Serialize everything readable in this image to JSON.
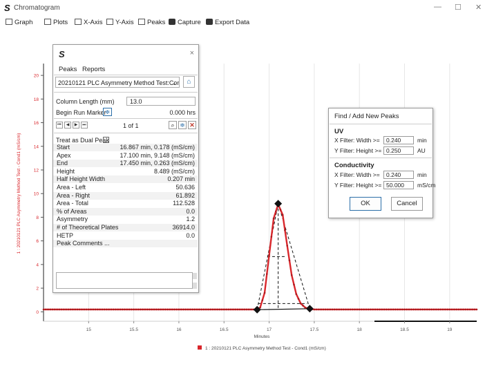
{
  "window": {
    "title": "Chromatogram",
    "logo": "S",
    "controls": [
      "—",
      "☐",
      "✕"
    ]
  },
  "toolbar": {
    "items": [
      "Graph",
      "Plots",
      "X-Axis",
      "Y-Axis",
      "Peaks",
      "Capture",
      "Export Data"
    ]
  },
  "panel": {
    "logo": "S",
    "close": "×",
    "menu": {
      "peaks": "Peaks",
      "reports": "Reports"
    },
    "selected_run": "20210121 PLC Asymmetry Method Test:Cond1",
    "column_length_label": "Column Length (mm)",
    "column_length_value": "13.0",
    "begin_run_marker_label": "Begin Run Marker",
    "begin_run_marker_value": "0.000 hrs",
    "pager": "1 of 1",
    "dual_peak_label": "Treat as Dual Peak",
    "rows": [
      {
        "k": "Start",
        "v": "16.867 min, 0.178  (mS/cm)"
      },
      {
        "k": "Apex",
        "v": "17.100 min, 9.148  (mS/cm)"
      },
      {
        "k": "End",
        "v": "17.450 min, 0.263  (mS/cm)"
      },
      {
        "k": "Height",
        "v": "8.489  (mS/cm)"
      },
      {
        "k": "Half Height Width",
        "v": "0.207 min"
      },
      {
        "k": "Area - Left",
        "v": "50.636"
      },
      {
        "k": "Area - Right",
        "v": "61.892"
      },
      {
        "k": "Area - Total",
        "v": "112.528"
      },
      {
        "k": "% of Areas",
        "v": "0.0"
      },
      {
        "k": "Asymmetry",
        "v": "1.2"
      },
      {
        "k": "# of Theoretical Plates",
        "v": "36914.0"
      },
      {
        "k": "HETP",
        "v": "0.0"
      },
      {
        "k": "Peak Comments ...",
        "v": ""
      }
    ]
  },
  "dialog": {
    "title": "Find / Add New Peaks",
    "uv": {
      "heading": "UV",
      "x_label": "X Filter: Width >=",
      "x_value": "0.240",
      "x_unit": "min",
      "y_label": "Y Filter: Height >=",
      "y_value": "0.250",
      "y_unit": "AU"
    },
    "cond": {
      "heading": "Conductivity",
      "x_label": "X Filter: Width >=",
      "x_value": "0.240",
      "x_unit": "min",
      "y_label": "Y Filter: Height >=",
      "y_value": "50.000",
      "y_unit": "mS/cm"
    },
    "ok": "OK",
    "cancel": "Cancel"
  },
  "chart_data": {
    "type": "line",
    "xlabel": "Minutes",
    "ylabel": "1 : 20210121 PLC Asymmetry Method Test - Cond1 (mS/cm)",
    "xlim": [
      14.5,
      19.3
    ],
    "ylim": [
      -0.8,
      21
    ],
    "x_ticks": [
      15,
      15.5,
      16,
      16.5,
      17,
      17.5,
      18,
      18.5,
      19
    ],
    "x_tick_labels": [
      "15",
      "15.5",
      "16",
      "16.5",
      "17",
      "17.5",
      "18",
      "18.5",
      "19"
    ],
    "y_ticks": [
      0,
      2,
      4,
      6,
      8,
      10,
      12,
      14,
      16,
      18,
      20
    ],
    "y_tick_labels": [
      "0",
      "2",
      "4",
      "6",
      "8",
      "10",
      "12",
      "14",
      "16",
      "18",
      "20"
    ],
    "grid": "vertical",
    "legend": "bottom-center",
    "series": [
      {
        "name": "1 : 20210121 PLC Asymmetry Method Test - Cond1 (mS/cm)",
        "color": "#d9262b",
        "x": [
          14.5,
          16.85,
          16.9,
          16.95,
          17.0,
          17.05,
          17.1,
          17.15,
          17.2,
          17.25,
          17.3,
          17.35,
          17.4,
          17.45,
          17.5,
          19.3
        ],
        "y": [
          0.2,
          0.2,
          0.35,
          1.6,
          4.8,
          7.9,
          9.1,
          8.2,
          5.6,
          3.1,
          1.5,
          0.7,
          0.35,
          0.25,
          0.2,
          0.2
        ]
      }
    ],
    "peak_markers": [
      {
        "label": "Start",
        "x": 16.867,
        "y": 0.178
      },
      {
        "label": "Apex",
        "x": 17.1,
        "y": 9.148
      },
      {
        "label": "End",
        "x": 17.45,
        "y": 0.263
      }
    ]
  }
}
